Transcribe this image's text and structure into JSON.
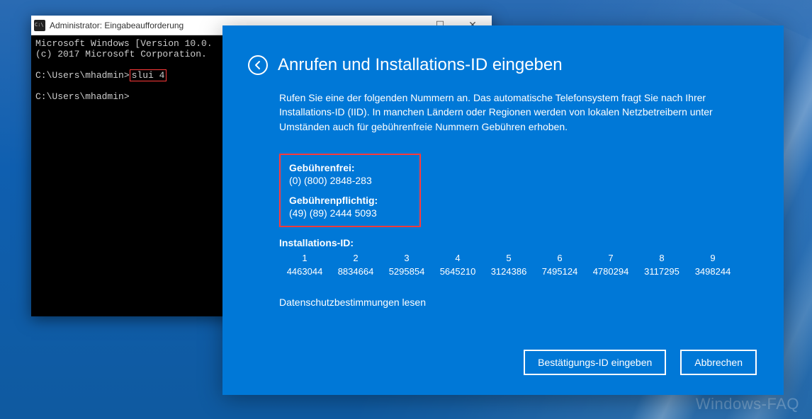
{
  "watermark": "Windows-FAQ",
  "cmd": {
    "title": "Administrator: Eingabeaufforderung",
    "line1": "Microsoft Windows [Version 10.0.",
    "line2": "(c) 2017 Microsoft Corporation.",
    "prompt1_prefix": "C:\\Users\\mhadmin>",
    "prompt1_cmd": "slui 4",
    "prompt2": "C:\\Users\\mhadmin>",
    "controls": {
      "min": "—",
      "max": "☐",
      "close": "✕"
    }
  },
  "activation": {
    "title": "Anrufen und Installations-ID eingeben",
    "description": "Rufen Sie eine der folgenden Nummern an. Das automatische Telefonsystem fragt Sie nach Ihrer Installations-ID (IID). In manchen Ländern oder Regionen werden von lokalen Netzbetreibern unter Umständen auch für gebührenfreie Nummern Gebühren erhoben.",
    "tollfree_label": "Gebührenfrei:",
    "tollfree_number": "(0) (800) 2848-283",
    "toll_label": "Gebührenpflichtig:",
    "toll_number": "(49) (89) 2444 5093",
    "iid_label": "Installations-ID:",
    "iid_headers": [
      "1",
      "2",
      "3",
      "4",
      "5",
      "6",
      "7",
      "8",
      "9"
    ],
    "iid_values": [
      "4463044",
      "8834664",
      "5295854",
      "5645210",
      "3124386",
      "7495124",
      "4780294",
      "3117295",
      "3498244"
    ],
    "privacy": "Datenschutzbestimmungen lesen",
    "btn_confirm": "Bestätigungs-ID eingeben",
    "btn_cancel": "Abbrechen"
  }
}
